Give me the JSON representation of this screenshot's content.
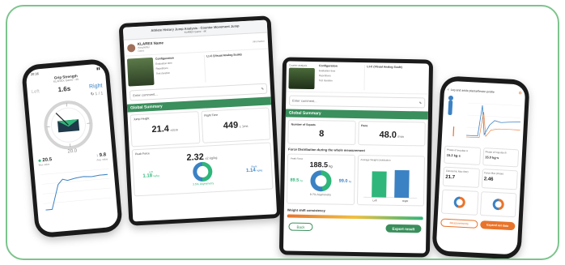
{
  "phone1": {
    "title": "Grip Strength",
    "subtitle": "KLAREX Game - 4K",
    "left_label": "Left",
    "time": "1.6s",
    "right_label": "Right",
    "count": "1 / 1",
    "count_label": "Repetitions",
    "gauge_value": "20.0",
    "stat1_value": "20.5",
    "stat1_label": "Max value",
    "stat2_value": "9.8",
    "stat2_label": "Avg. value",
    "status_time": "20:36"
  },
  "tablet1": {
    "header": "Athlete History Jump Analysis - Counter Movement Jump",
    "subheader": "KLAREX Game - 4K",
    "athlete_name": "KLAREX Name",
    "athlete_meta": "Weightlifter",
    "athlete_date": "Dates",
    "side_label": "Information",
    "config_label": "Configuration",
    "config_items": [
      "Evaluation time",
      "Repetitions",
      "Test duration"
    ],
    "scale_label": "Lt-C (Visual Analog Scale)",
    "comment_placeholder": "Enter comment...",
    "summary": "Global Summary",
    "jump_height_label": "Jump Height",
    "jump_height_value": "21.4",
    "jump_height_unit": "±2cm",
    "flight_time_label": "Flight Time",
    "flight_time_value": "449",
    "flight_time_unit": "± 1ms",
    "peak_force_label": "Peak Force",
    "peak_force_value": "2.32",
    "peak_force_unit": "±2 kg/kg",
    "left_value": "1.18",
    "left_unit": "kg/kg",
    "right_value": "1.14",
    "right_unit": "kg/kg",
    "asymmetry": "3.5% Asymmetry",
    "left_label": "Left",
    "right_label": "Right"
  },
  "tablet2": {
    "athlete_label": "Counter analysis",
    "config_label": "Configuration",
    "config_items": [
      "Evaluation time",
      "Repetitions",
      "Test duration"
    ],
    "scale_label": "Lt-C (Visual Analog Scale)",
    "comment_placeholder": "Enter comment...",
    "summary": "Global Summary",
    "squats_label": "Number of Squats",
    "squats_value": "8",
    "pace_label": "Pace",
    "pace_value": "48.0",
    "pace_unit": "/min",
    "force_title": "Force Distribution during the whole measurement",
    "peak_label": "Peak Force",
    "peak_value": "188.5",
    "peak_unit": "kg",
    "avg_label": "Average Weight Distribution",
    "left_value": "89.5",
    "right_value": "99.0",
    "left_unit": "kg",
    "right_unit": "kg",
    "asym": "9.7% Asymmetry",
    "bar_left_label": "Left",
    "bar_right_label": "Right",
    "consistency_title": "Weight shift consistency",
    "back_button": "Back",
    "export_button": "Export result"
  },
  "phone2": {
    "title": "Leg and ankle plantarflexion profile",
    "phase_labels": [
      "Phase of Impulse A",
      "Phase of Impulse B"
    ],
    "phase_values": [
      "15.2 kg·s",
      "15.0 kg·s"
    ],
    "metric_labels": [
      "Concentric Max RFD",
      "Force Max (Peak)"
    ],
    "metric_values": [
      "21.7",
      "2.46"
    ],
    "left_button": "Measurements",
    "right_button": "Expand set data"
  },
  "colors": {
    "accent_green": "#3a8f5c",
    "bar_green": "#2fb67a",
    "bar_blue": "#3b82c4",
    "orange": "#e8742b",
    "frame": "#7dc48d"
  }
}
